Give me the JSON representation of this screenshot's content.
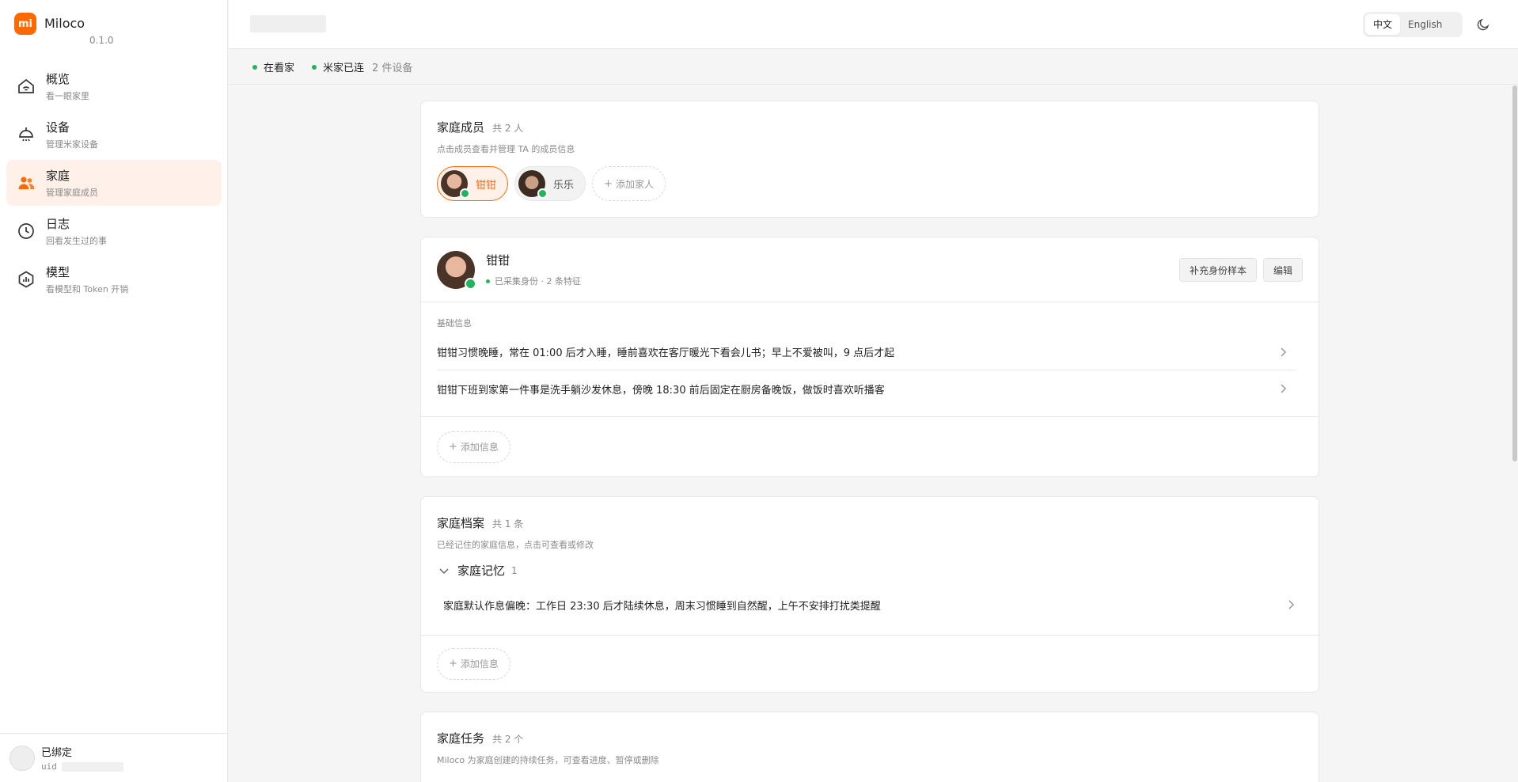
{
  "brand": {
    "logo_text": "mi",
    "name": "Miloco",
    "version": "0.1.0"
  },
  "nav": [
    {
      "id": "overview",
      "label": "概览",
      "sub": "看一眼家里",
      "icon": "home-wifi-icon"
    },
    {
      "id": "devices",
      "label": "设备",
      "sub": "管理米家设备",
      "icon": "ceiling-lamp-icon"
    },
    {
      "id": "family",
      "label": "家庭",
      "sub": "管理家庭成员",
      "icon": "users-icon",
      "active": true
    },
    {
      "id": "logs",
      "label": "日志",
      "sub": "回看发生过的事",
      "icon": "clock-icon"
    },
    {
      "id": "model",
      "label": "模型",
      "sub": "看模型和 Token 开销",
      "icon": "model-chart-icon"
    }
  ],
  "footer": {
    "title": "已绑定",
    "uid_label": "uid"
  },
  "header": {
    "lang_zh": "中文",
    "lang_en": "English",
    "theme_icon": "moon-icon"
  },
  "status": {
    "home": "在看家",
    "mijia": "米家已连",
    "devices": "2 件设备"
  },
  "members_card": {
    "title": "家庭成员",
    "count": "共 2 人",
    "desc": "点击成员查看并管理 TA 的成员信息",
    "members": [
      {
        "name": "钳钳"
      },
      {
        "name": "乐乐"
      }
    ],
    "add_label": "添加家人"
  },
  "profile_card": {
    "name": "钳钳",
    "status": "已采集身份 · 2 条特征",
    "btn_sample": "补充身份样本",
    "btn_edit": "编辑",
    "section": "基础信息",
    "rows": [
      "钳钳习惯晚睡，常在 01:00 后才入睡，睡前喜欢在客厅暖光下看会儿书；早上不爱被叫，9 点后才起",
      "钳钳下班到家第一件事是洗手躺沙发休息，傍晚 18:30 前后固定在厨房备晚饭，做饭时喜欢听播客"
    ],
    "add_label": "添加信息"
  },
  "archive_card": {
    "title": "家庭档案",
    "count": "共 1 条",
    "desc": "已经记住的家庭信息，点击可查看或修改",
    "group": "家庭记忆",
    "group_count": "1",
    "rows": [
      "家庭默认作息偏晚：工作日 23:30 后才陆续休息，周末习惯睡到自然醒，上午不安排打扰类提醒"
    ],
    "add_label": "添加信息"
  },
  "tasks_card": {
    "title": "家庭任务",
    "count": "共 2 个",
    "desc": "Miloco 为家庭创建的持续任务，可查看进度、暂停或删除"
  },
  "colors": {
    "accent": "#ff6900",
    "ok": "#22b35e"
  }
}
